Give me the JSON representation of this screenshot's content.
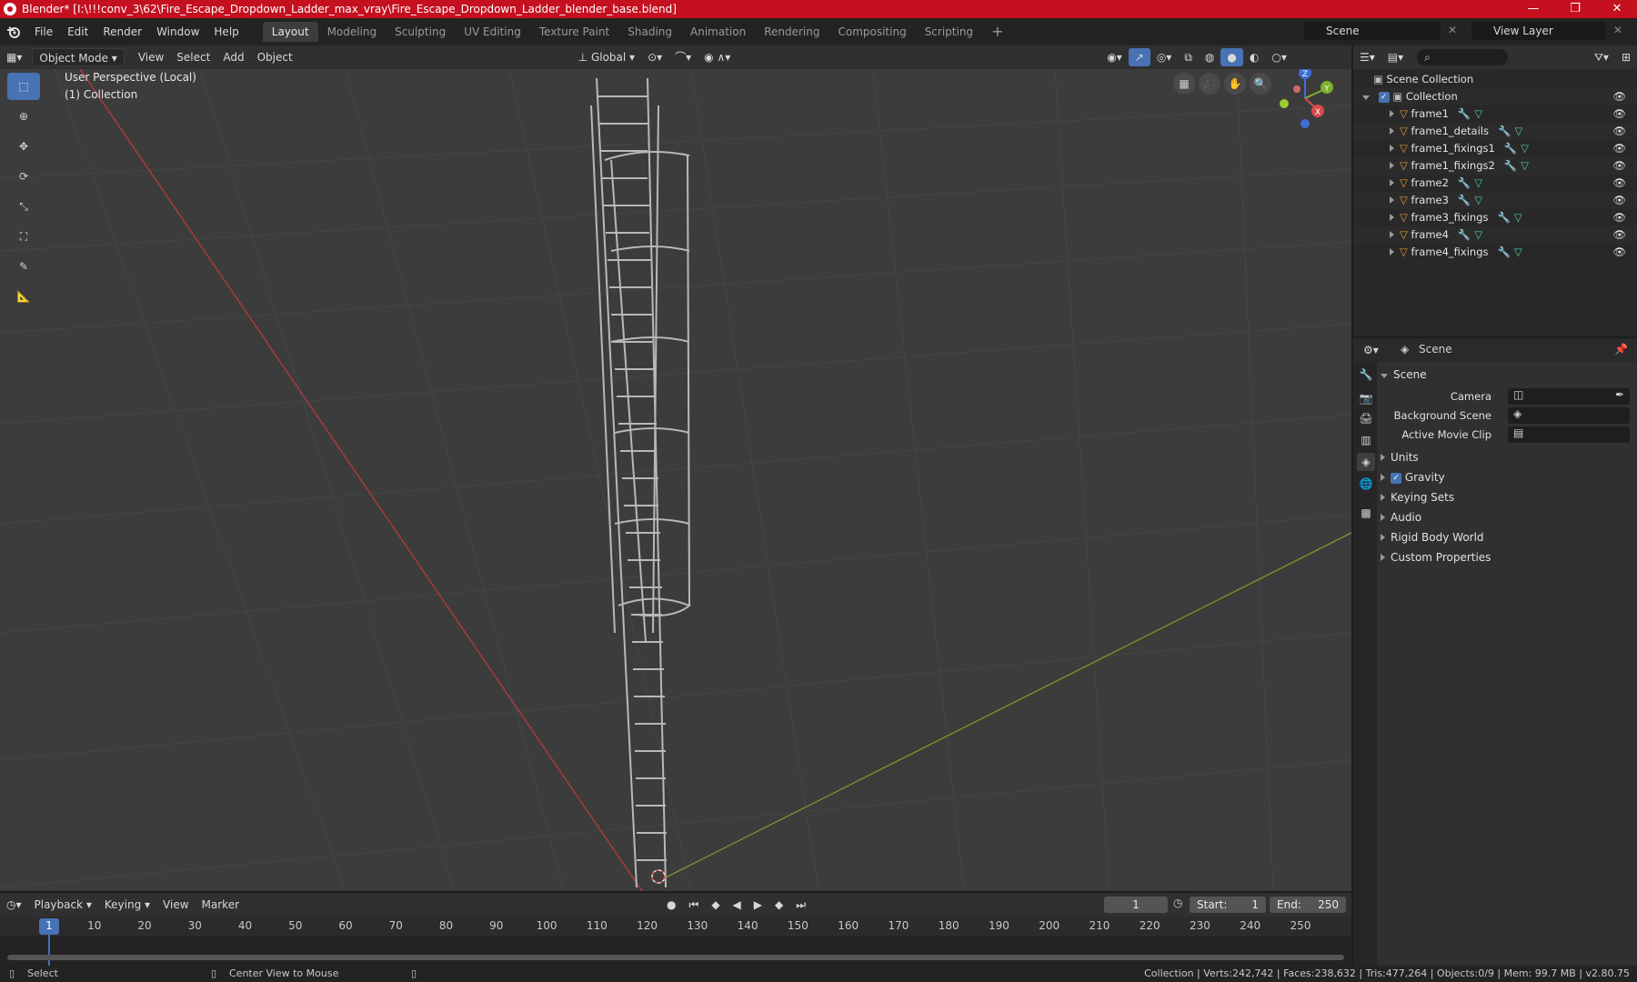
{
  "window": {
    "title": "Blender* [I:\\!!!conv_3\\62\\Fire_Escape_Dropdown_Ladder_max_vray\\Fire_Escape_Dropdown_Ladder_blender_base.blend]",
    "minimize": "—",
    "maximize": "❐",
    "close": "✕"
  },
  "menu": [
    "File",
    "Edit",
    "Render",
    "Window",
    "Help"
  ],
  "workspaces": [
    "Layout",
    "Modeling",
    "Sculpting",
    "UV Editing",
    "Texture Paint",
    "Shading",
    "Animation",
    "Rendering",
    "Compositing",
    "Scripting"
  ],
  "workspace_add": "+",
  "scene_name": "Scene",
  "view_layer": "View Layer",
  "viewport": {
    "mode": "Object Mode",
    "menus": [
      "View",
      "Select",
      "Add",
      "Object"
    ],
    "orientation": "Global",
    "overlay_text_1": "User Perspective (Local)",
    "overlay_text_2": "(1) Collection",
    "gizmo": {
      "x": "X",
      "y": "Y",
      "z": "Z"
    }
  },
  "outliner": {
    "root": "Scene Collection",
    "collection": "Collection",
    "objects": [
      "frame1",
      "frame1_details",
      "frame1_fixings1",
      "frame1_fixings2",
      "frame2",
      "frame3",
      "frame3_fixings",
      "frame4",
      "frame4_fixings"
    ]
  },
  "properties": {
    "context": "Scene",
    "panel_title": "Scene",
    "fields": [
      {
        "label": "Camera"
      },
      {
        "label": "Background Scene"
      },
      {
        "label": "Active Movie Clip"
      }
    ],
    "sections": [
      "Units",
      "Gravity",
      "Keying Sets",
      "Audio",
      "Rigid Body World",
      "Custom Properties"
    ],
    "gravity_enabled": true
  },
  "timeline": {
    "menus": [
      "Playback",
      "Keying",
      "View",
      "Marker"
    ],
    "current_frame": "1",
    "start_label": "Start:",
    "start": "1",
    "end_label": "End:",
    "end": "250",
    "ruler": [
      "1",
      "10",
      "20",
      "30",
      "40",
      "50",
      "60",
      "70",
      "80",
      "90",
      "100",
      "110",
      "120",
      "130",
      "140",
      "150",
      "160",
      "170",
      "180",
      "190",
      "200",
      "210",
      "220",
      "230",
      "240",
      "250"
    ]
  },
  "status": {
    "select": "Select",
    "center_view": "Center View to Mouse",
    "stats": "Collection | Verts:242,742 | Faces:238,632 | Tris:477,264 | Objects:0/9 | Mem: 99.7 MB | v2.80.75"
  },
  "colors": {
    "titlebar": "#c4101f",
    "accent": "#4772b3",
    "x_axis": "#b73b3b",
    "y_axis": "#7a9a2a",
    "object_orange": "#e39a3b"
  }
}
